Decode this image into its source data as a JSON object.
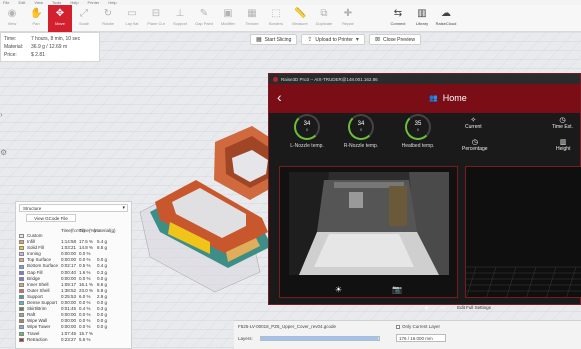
{
  "menu": [
    "File",
    "Edit",
    "View",
    "Tools",
    "Help",
    "Printer",
    "Help"
  ],
  "toolbar": [
    {
      "label": "View",
      "icon": "eye-icon"
    },
    {
      "label": "Pan",
      "icon": "pan-icon"
    },
    {
      "label": "Move",
      "icon": "move-icon",
      "active": true
    },
    {
      "label": "Scale",
      "icon": "scale-icon"
    },
    {
      "label": "Rotate",
      "icon": "rotate-icon"
    },
    {
      "label": "Lay flat",
      "icon": "lay-flat-icon"
    },
    {
      "label": "Plane Cut",
      "icon": "plane-cut-icon"
    },
    {
      "label": "Support",
      "icon": "support-icon"
    },
    {
      "label": "Gap Paint",
      "icon": "gap-paint-icon"
    },
    {
      "label": "Modifier",
      "icon": "modifier-icon"
    },
    {
      "label": "Texture",
      "icon": "texture-icon"
    },
    {
      "label": "Borders",
      "icon": "borders-icon"
    },
    {
      "label": "Measure",
      "icon": "measure-icon"
    },
    {
      "label": "Duplicate",
      "icon": "duplicate-icon"
    },
    {
      "label": "Repair",
      "icon": "repair-icon"
    },
    {
      "label": "Connect",
      "icon": "connect-icon",
      "dark": true
    },
    {
      "label": "Library",
      "icon": "library-icon",
      "dark": true
    },
    {
      "label": "RaiseCloud",
      "icon": "raisecloud-icon",
      "dark": true
    }
  ],
  "info": {
    "time_label": "Time:",
    "time_value": "7 hours, 8 min, 10 sec",
    "material_label": "Material:",
    "material_value": "36.9 g / 12.69 m",
    "price_label": "Price:",
    "price_value": "$ 2.81"
  },
  "actions": {
    "start_slicing": "Start Slicing",
    "upload": "Upload to Printer",
    "close_preview": "Close Preview"
  },
  "structure": {
    "dropdown": "Structure",
    "view_gcode": "View GCode File",
    "headers": [
      "Time(h:m:s)",
      "Time(%)",
      "Material(g)"
    ],
    "rows": [
      {
        "name": "Custom",
        "color": "#e8e8e8",
        "time": "",
        "pct": "",
        "mat": ""
      },
      {
        "name": "Infill",
        "color": "#e9a23b",
        "time": "1:14:58",
        "pct": "17.5 %",
        "mat": "5.4 g"
      },
      {
        "name": "Solid Fill",
        "color": "#f0c419",
        "time": "1:03:21",
        "pct": "14.8 %",
        "mat": "8.5 g"
      },
      {
        "name": "Ironing",
        "color": "#c6b9e8",
        "time": "0:00:00",
        "pct": "0.0 %",
        "mat": ""
      },
      {
        "name": "Top Surface",
        "color": "#e0ad5a",
        "time": "0:00:00",
        "pct": "0.0 %",
        "mat": "0.0 g"
      },
      {
        "name": "Bottom Surface",
        "color": "#6ea6d8",
        "time": "0:02:17",
        "pct": "0.5 %",
        "mat": "0.4 g"
      },
      {
        "name": "Gap Fill",
        "color": "#8f6fd0",
        "time": "0:00:40",
        "pct": "1.6 %",
        "mat": "0.3 g"
      },
      {
        "name": "Bridge",
        "color": "#6d7de0",
        "time": "0:00:00",
        "pct": "0.0 %",
        "mat": "0.0 g"
      },
      {
        "name": "Inner Shell",
        "color": "#e4a07a",
        "time": "1:09:17",
        "pct": "16.1 %",
        "mat": "8.6 g"
      },
      {
        "name": "Outer Shell",
        "color": "#d9625b",
        "time": "1:38:52",
        "pct": "23.0 %",
        "mat": "5.9 g"
      },
      {
        "name": "Support",
        "color": "#3aa7a0",
        "time": "0:25:53",
        "pct": "6.0 %",
        "mat": "2.9 g"
      },
      {
        "name": "Dense Support",
        "color": "#5fb3d4",
        "time": "0:00:00",
        "pct": "0.0 %",
        "mat": "0.0 g"
      },
      {
        "name": "Skirt/Brim",
        "color": "#5c8a3a",
        "time": "0:01:45",
        "pct": "0.4 %",
        "mat": "0.3 g"
      },
      {
        "name": "Raft",
        "color": "#a0a0a0",
        "time": "0:00:00",
        "pct": "0.0 %",
        "mat": "0.0 g"
      },
      {
        "name": "Wipe Wall",
        "color": "#b07c5a",
        "time": "0:00:00",
        "pct": "0.0 %",
        "mat": "0.0 g"
      },
      {
        "name": "Wipe Tower",
        "color": "#7ab0c8",
        "time": "0:00:00",
        "pct": "0.0 %",
        "mat": "0.0 g"
      },
      {
        "name": "Travel",
        "color": "#5cc06b",
        "time": "1:07:45",
        "pct": "15.7 %",
        "mat": ""
      },
      {
        "name": "Retraction",
        "color": "#b03030",
        "time": "0:23:27",
        "pct": "5.5 %",
        "mat": ""
      }
    ]
  },
  "layerbar": {
    "filename": "F525-LV-00018_PZ6_Upper_Cover_rev04.gcode",
    "layers_label": "Layers:",
    "slider_fraction": 0.99,
    "only_current": "Only Current Layer",
    "layer_value": "176 / 16.000 mm"
  },
  "window": {
    "title": "Raise3D Pro3 -- AIX-TRUDER@148.001.162.86",
    "header": "Home",
    "gauges": [
      {
        "value": "34",
        "target": "0",
        "label": "L-Nozzle temp."
      },
      {
        "value": "34",
        "target": "0",
        "label": "R-Nozzle temp."
      },
      {
        "value": "35",
        "target": "0",
        "label": "Heatbed temp."
      }
    ],
    "current_label": "Current",
    "percentage_label": "Percentage",
    "time_est_label": "Time Est.",
    "height_label": "Height"
  },
  "edit_bar": {
    "plus": "+",
    "minus": "–",
    "edit_full": "Edit Full Settings"
  }
}
